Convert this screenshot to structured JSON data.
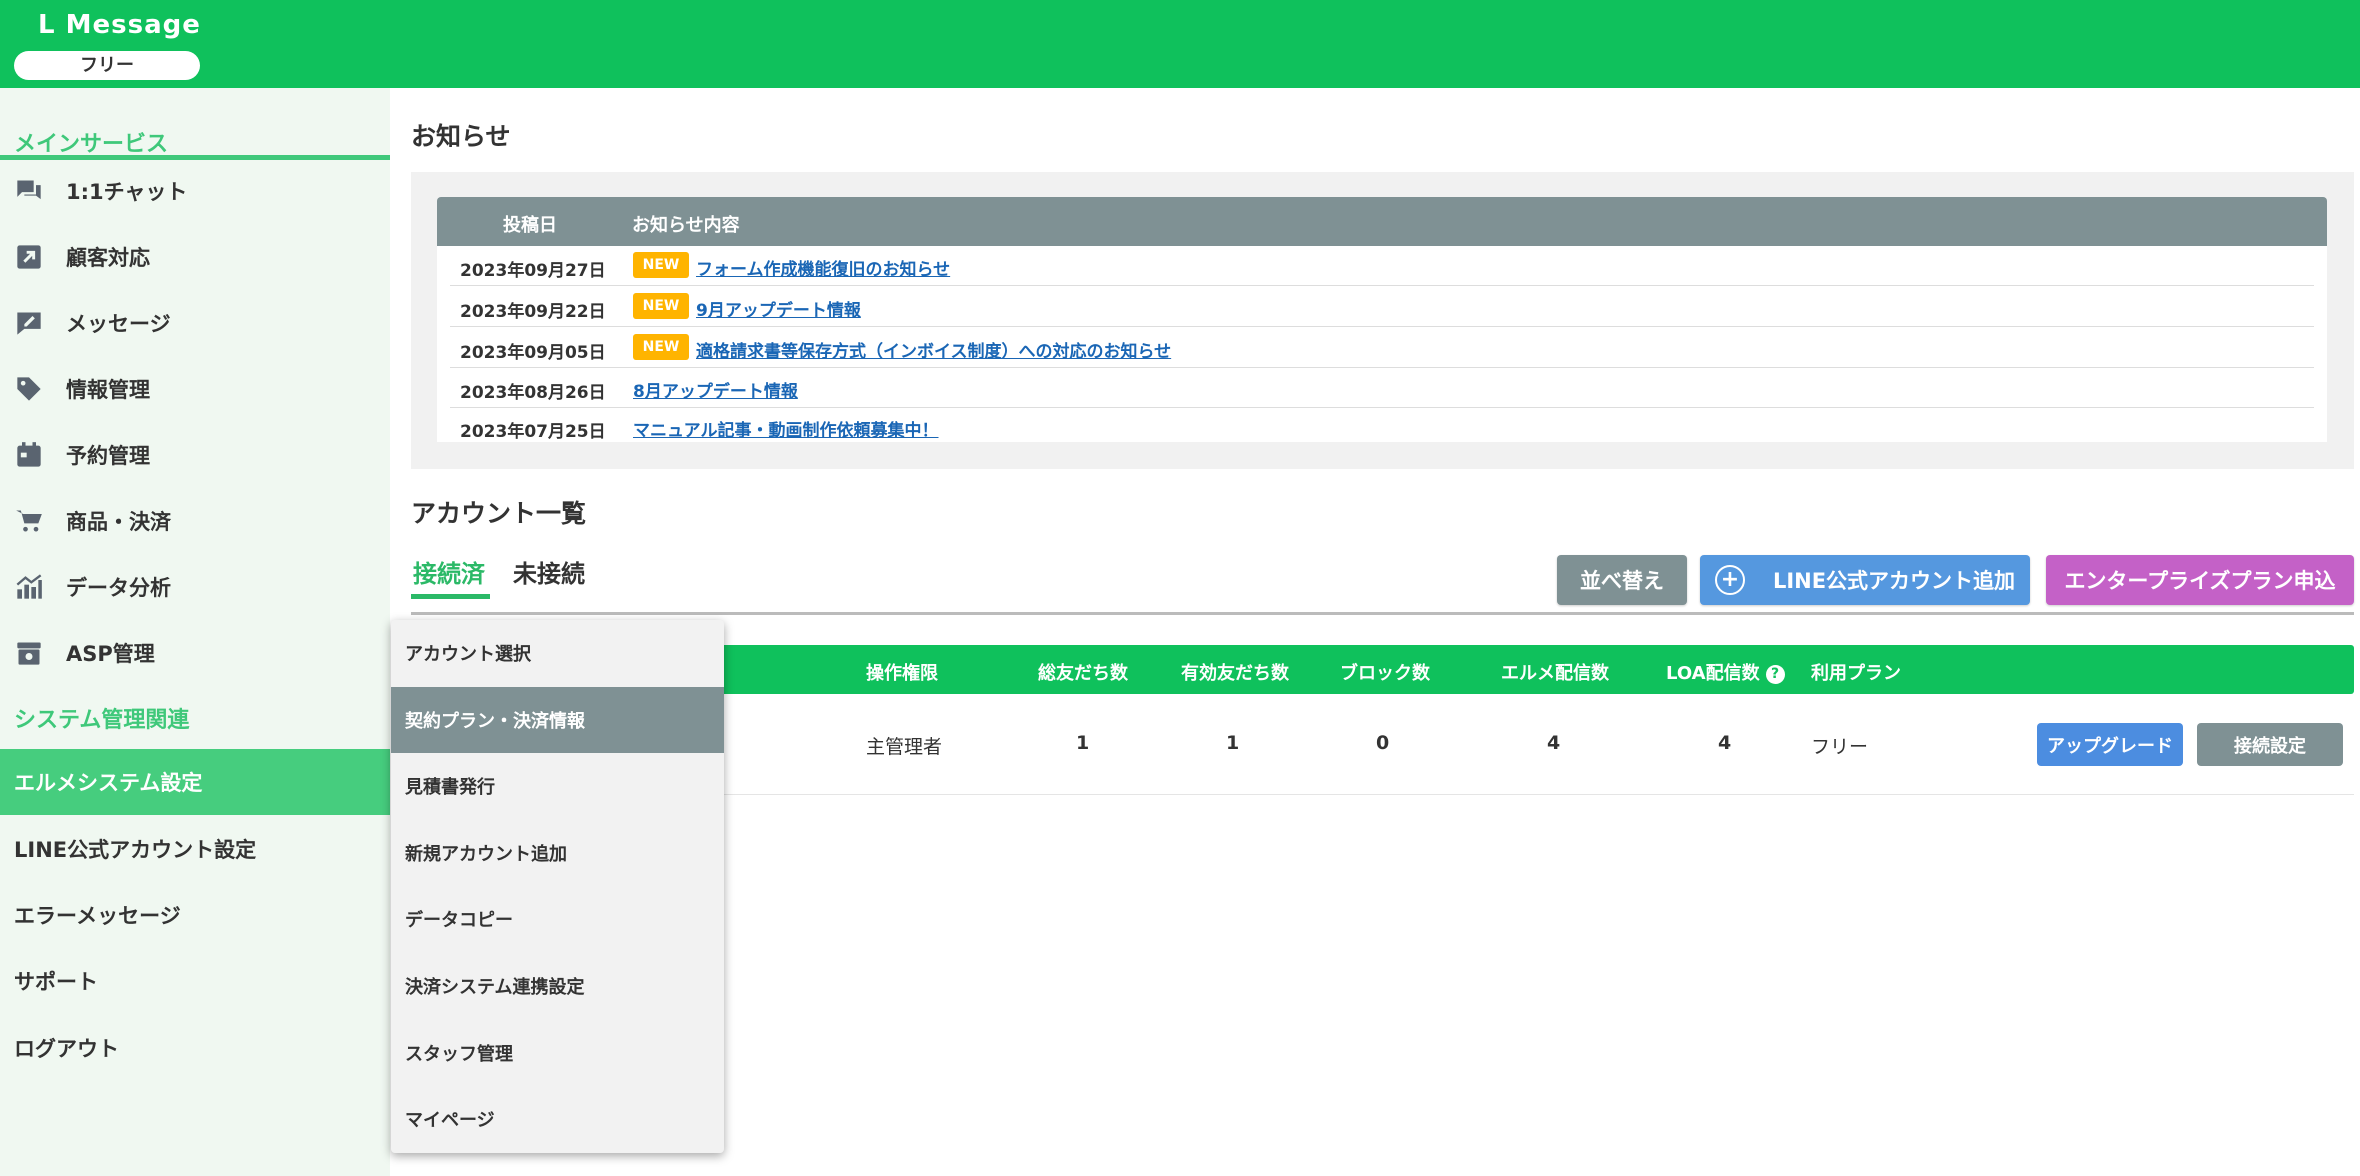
{
  "header": {
    "logo": "L Message",
    "plan": "フリー"
  },
  "sidebar": {
    "main_heading": "メインサービス",
    "main_items": [
      {
        "label": "1:1チャット",
        "icon": "chat-icon"
      },
      {
        "label": "顧客対応",
        "icon": "arrow-out-icon"
      },
      {
        "label": "メッセージ",
        "icon": "edit-message-icon"
      },
      {
        "label": "情報管理",
        "icon": "tag-icon"
      },
      {
        "label": "予約管理",
        "icon": "calendar-icon"
      },
      {
        "label": "商品・決済",
        "icon": "cart-icon"
      },
      {
        "label": "データ分析",
        "icon": "chart-icon"
      },
      {
        "label": "ASP管理",
        "icon": "asp-box-icon"
      }
    ],
    "system_heading": "システム管理関連",
    "system_items": [
      {
        "label": "エルメシステム設定",
        "active": true
      },
      {
        "label": "LINE公式アカウント設定"
      },
      {
        "label": "エラーメッセージ"
      },
      {
        "label": "サポート"
      },
      {
        "label": "ログアウト"
      }
    ]
  },
  "news": {
    "title": "お知らせ",
    "col_date": "投稿日",
    "col_content": "お知らせ内容",
    "new_badge": "NEW",
    "rows": [
      {
        "date": "2023年09月27日",
        "is_new": true,
        "text": "フォーム作成機能復旧のお知らせ"
      },
      {
        "date": "2023年09月22日",
        "is_new": true,
        "text": "9月アップデート情報"
      },
      {
        "date": "2023年09月05日",
        "is_new": true,
        "text": "適格請求書等保存方式（インボイス制度）への対応のお知らせ"
      },
      {
        "date": "2023年08月26日",
        "is_new": false,
        "text": "8月アップデート情報"
      },
      {
        "date": "2023年07月25日",
        "is_new": false,
        "text": "マニュアル記事・動画制作依頼募集中！"
      }
    ]
  },
  "accounts": {
    "title": "アカウント一覧",
    "tab_connected": "接続済",
    "tab_unconnected": "未接続",
    "btn_sort": "並べ替え",
    "btn_add": "LINE公式アカウント追加",
    "btn_enterprise": "エンタープライズプラン申込",
    "columns": {
      "permission": "操作権限",
      "total_friends": "総友だち数",
      "valid_friends": "有効友だち数",
      "blocks": "ブロック数",
      "elme_sends": "エルメ配信数",
      "loa_sends": "LOA配信数",
      "plan": "利用プラン"
    },
    "row": {
      "permission": "主管理者",
      "total_friends": "1",
      "valid_friends": "1",
      "blocks": "0",
      "elme_sends": "4",
      "loa_sends": "4",
      "plan": "フリー",
      "btn_upgrade": "アップグレード",
      "btn_connect": "接続設定"
    }
  },
  "dropdown": {
    "items": [
      {
        "label": "アカウント選択"
      },
      {
        "label": "契約プラン・決済情報",
        "active": true
      },
      {
        "label": "見積書発行"
      },
      {
        "label": "新規アカウント追加"
      },
      {
        "label": "データコピー"
      },
      {
        "label": "決済システム連携設定"
      },
      {
        "label": "スタッフ管理"
      },
      {
        "label": "マイページ"
      }
    ]
  },
  "colors": {
    "brand_green": "#0fc15c",
    "sidebar_bg": "#f0f8f1",
    "active_green": "#46cd7e",
    "gray_header": "#7f9194",
    "link_blue": "#1a66b5",
    "new_badge": "#ffb400",
    "enterprise_purple": "#c461c7",
    "add_blue": "#5598df"
  }
}
